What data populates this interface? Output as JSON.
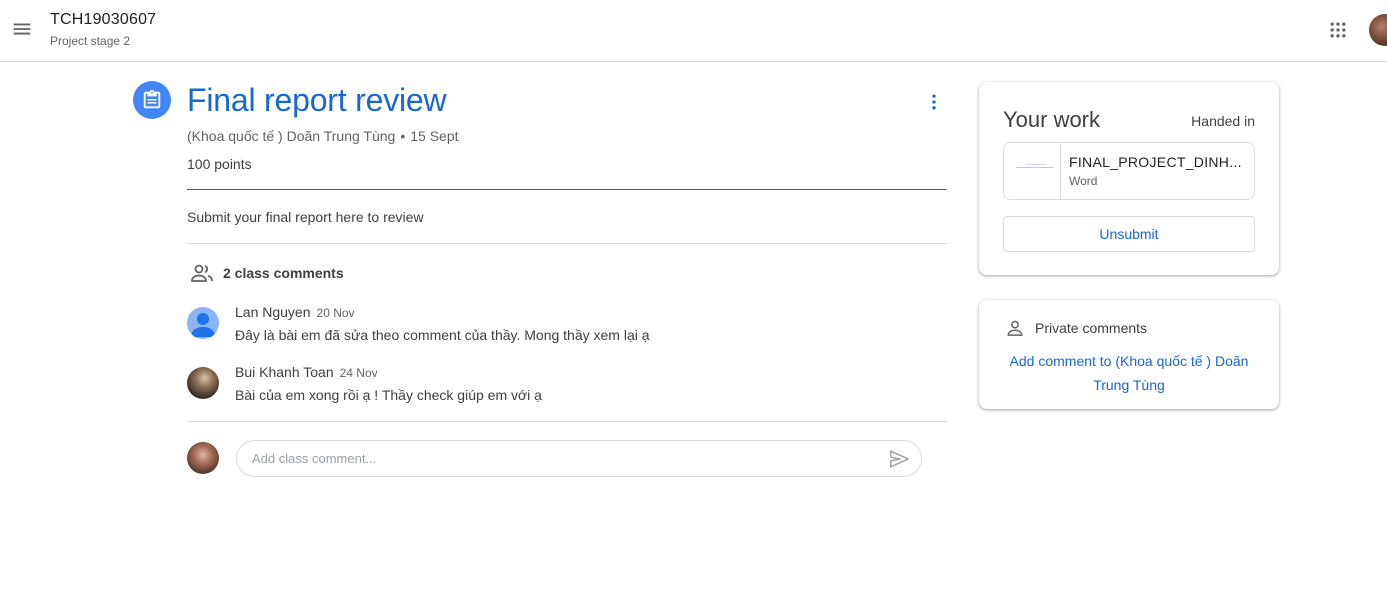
{
  "header": {
    "class_title": "TCH19030607",
    "class_subtitle": "Project stage 2",
    "menu_icon": "hamburger-menu-icon",
    "apps_icon": "google-apps-grid-icon"
  },
  "assignment": {
    "icon": "assignment-icon",
    "title": "Final report review",
    "teacher": "(Khoa quốc tế ) Doãn Trung Tùng",
    "separator": "•",
    "date": "15 Sept",
    "points": "100 points",
    "description": "Submit your final report here to review"
  },
  "comments": {
    "header_icon": "people-icon",
    "count_label": "2 class comments",
    "items": [
      {
        "author": "Lan Nguyen",
        "date": "20 Nov",
        "text": "Đây là bài em đã sửa theo comment của thầy. Mong thầy xem lại ạ"
      },
      {
        "author": "Bui Khanh Toan",
        "date": "24 Nov",
        "text": "Bài của em xong rồi ạ ! Thầy check giúp em với ạ"
      }
    ],
    "input_placeholder": "Add class comment...",
    "send_icon": "send-icon"
  },
  "your_work": {
    "title": "Your work",
    "status": "Handed in",
    "attachment": {
      "name": "FINAL_PROJECT_DINH...",
      "type": "Word"
    },
    "unsubmit_label": "Unsubmit"
  },
  "private_comments": {
    "icon": "person-icon",
    "title": "Private comments",
    "add_link": "Add comment to (Khoa quốc tế ) Doãn Trung Tùng"
  },
  "colors": {
    "accent_blue": "#1967d2",
    "icon_blue": "#4285f4",
    "divider": "#dadce0",
    "text_primary": "#3c4043",
    "text_secondary": "#5f6368"
  }
}
